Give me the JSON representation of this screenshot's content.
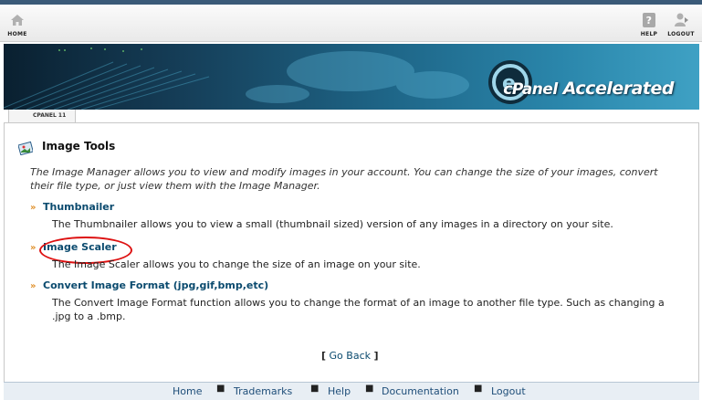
{
  "nav": {
    "home_label": "HOME",
    "help_label": "HELP",
    "logout_label": "LOGOUT"
  },
  "banner": {
    "brand_cpanel": "cPanel",
    "brand_accelerated": "Accelerated"
  },
  "breadcrumb": {
    "label": "CPANEL 11"
  },
  "page": {
    "title": "Image Tools",
    "intro": "The Image Manager allows you to view and modify images in your account. You can change the size of your images, convert their file type, or just view them with the Image Manager."
  },
  "tools": [
    {
      "label": "Thumbnailer",
      "description": "The Thumbnailer allows you to view a small (thumbnail sized) version of any images in a directory on your site."
    },
    {
      "label": "Image Scaler",
      "description": "The Image Scaler allows you to change the size of an image on your site."
    },
    {
      "label": "Convert Image Format (jpg,gif,bmp,etc)",
      "description": "The Convert Image Format function allows you to change the format of an image to another file type. Such as changing a .jpg to a .bmp."
    }
  ],
  "goback": {
    "open": "[",
    "label": "Go Back",
    "close": "]"
  },
  "footer": {
    "links": [
      "Home",
      "Trademarks",
      "Help",
      "Documentation",
      "Logout"
    ]
  },
  "colors": {
    "link": "#0a4a6e",
    "highlight_circle": "#dd1111",
    "footer_bg": "#e8eef4"
  }
}
